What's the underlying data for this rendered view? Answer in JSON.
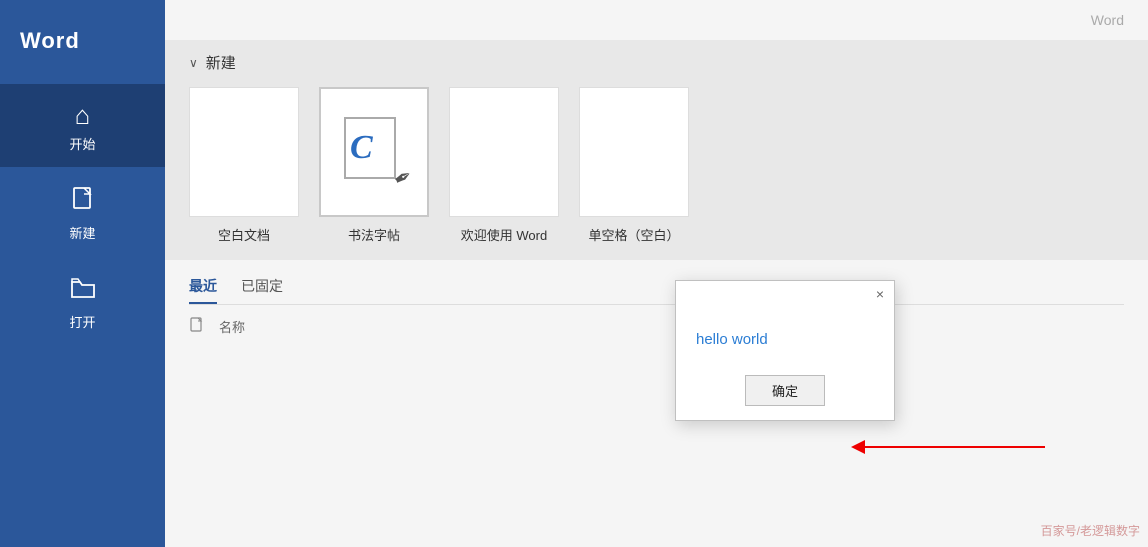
{
  "sidebar": {
    "title": "Word",
    "items": [
      {
        "id": "home",
        "label": "开始",
        "icon": "⌂",
        "active": true
      },
      {
        "id": "new",
        "label": "新建",
        "icon": "🗋",
        "active": false
      },
      {
        "id": "open",
        "label": "打开",
        "icon": "📂",
        "active": false
      }
    ]
  },
  "topbar": {
    "word_label": "Word"
  },
  "new_section": {
    "header": "新建",
    "chevron": "∨",
    "templates": [
      {
        "id": "blank",
        "label": "空白文档",
        "type": "blank"
      },
      {
        "id": "calligraphy",
        "label": "书法字帖",
        "type": "calligraphy"
      },
      {
        "id": "welcome",
        "label": "欢迎使用 Word",
        "type": "welcome"
      },
      {
        "id": "single-space",
        "label": "单空格（空白）",
        "type": "single-space"
      }
    ]
  },
  "bottom_section": {
    "tabs": [
      {
        "id": "recent",
        "label": "最近",
        "active": true
      },
      {
        "id": "pinned",
        "label": "已固定",
        "active": false
      }
    ],
    "table_header": {
      "name_col": "名称"
    }
  },
  "dialog": {
    "message": "hello world",
    "ok_label": "确定",
    "close_icon": "×"
  },
  "watermark": {
    "text": "百家号/老逻辑数字"
  },
  "colors": {
    "sidebar_bg": "#2b579a",
    "sidebar_active": "#1e3f73",
    "accent": "#2b579a",
    "dialog_text": "#2b7dd4",
    "arrow_color": "#dd0000"
  }
}
